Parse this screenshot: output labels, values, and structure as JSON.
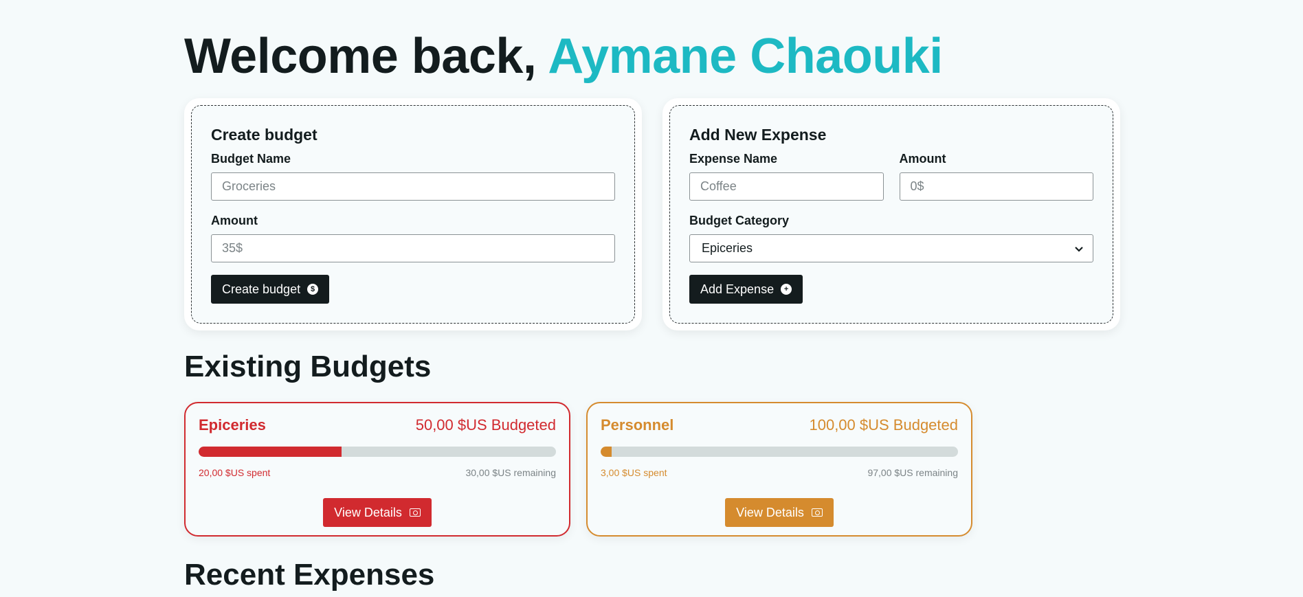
{
  "welcome": {
    "prefix": "Welcome back, ",
    "user_name": "Aymane Chaouki"
  },
  "create_budget": {
    "title": "Create budget",
    "name_label": "Budget Name",
    "name_placeholder": "Groceries",
    "amount_label": "Amount",
    "amount_placeholder": "35$",
    "button_label": "Create budget",
    "button_icon": "dollar-circle-icon"
  },
  "add_expense": {
    "title": "Add New Expense",
    "name_label": "Expense Name",
    "name_placeholder": "Coffee",
    "amount_label": "Amount",
    "amount_placeholder": "0$",
    "category_label": "Budget Category",
    "category_selected": "Epiceries",
    "button_label": "Add Expense",
    "button_icon": "plus-circle-icon"
  },
  "existing_budgets": {
    "title": "Existing Budgets",
    "budgets": [
      {
        "name": "Epiceries",
        "budgeted": "50,00 $US Budgeted",
        "spent": "20,00 $US spent",
        "remaining": "30,00 $US remaining",
        "progress": 0.4,
        "color": "#d12a2f",
        "button_label": "View Details",
        "button_icon": "money-bill-icon"
      },
      {
        "name": "Personnel",
        "budgeted": "100,00 $US Budgeted",
        "spent": "3,00 $US spent",
        "remaining": "97,00 $US remaining",
        "progress": 0.03,
        "color": "#d58b2e",
        "button_label": "View Details",
        "button_icon": "money-bill-icon"
      }
    ]
  },
  "recent_expenses": {
    "title": "Recent Expenses"
  },
  "colors": {
    "accent": "#1db9c3",
    "dark": "#141c1e",
    "background": "#f5fafb"
  }
}
